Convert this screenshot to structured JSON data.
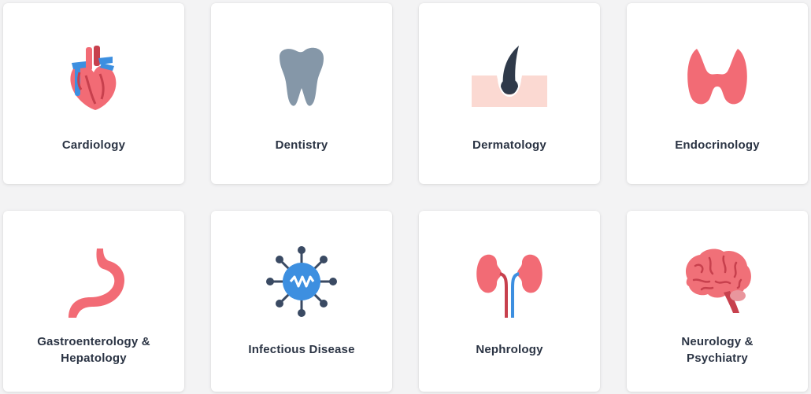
{
  "specialties": [
    {
      "id": "cardiology",
      "lines": [
        "Cardiology"
      ],
      "icon": "heart-icon"
    },
    {
      "id": "dentistry",
      "lines": [
        "Dentistry"
      ],
      "icon": "tooth-icon"
    },
    {
      "id": "dermatology",
      "lines": [
        "Dermatology"
      ],
      "icon": "skin-hair-icon"
    },
    {
      "id": "endocrinology",
      "lines": [
        "Endocrinology"
      ],
      "icon": "thyroid-icon"
    },
    {
      "id": "gastroenterology-hepatology",
      "lines": [
        "Gastroenterology &",
        "Hepatology"
      ],
      "icon": "stomach-icon"
    },
    {
      "id": "infectious-disease",
      "lines": [
        "Infectious Disease"
      ],
      "icon": "virus-icon"
    },
    {
      "id": "nephrology",
      "lines": [
        "Nephrology"
      ],
      "icon": "kidneys-icon"
    },
    {
      "id": "neurology-psychiatry",
      "lines": [
        "Neurology &",
        "Psychiatry"
      ],
      "icon": "brain-icon"
    }
  ],
  "colors": {
    "page_bg": "#f3f3f4",
    "card_bg": "#ffffff",
    "label_text": "#2b3444",
    "organ_red": "#f26b75",
    "organ_dark_red": "#c7404d",
    "vessel_blue": "#3d8fe0",
    "tooth_gray": "#8597a8",
    "skin_pink": "#fbd9d2",
    "hair_dark": "#2f3a4a",
    "virus_blue": "#3d8fe0",
    "virus_node": "#3a4a63",
    "brain_pink": "#f07078",
    "brain_stem": "#e9969d"
  }
}
